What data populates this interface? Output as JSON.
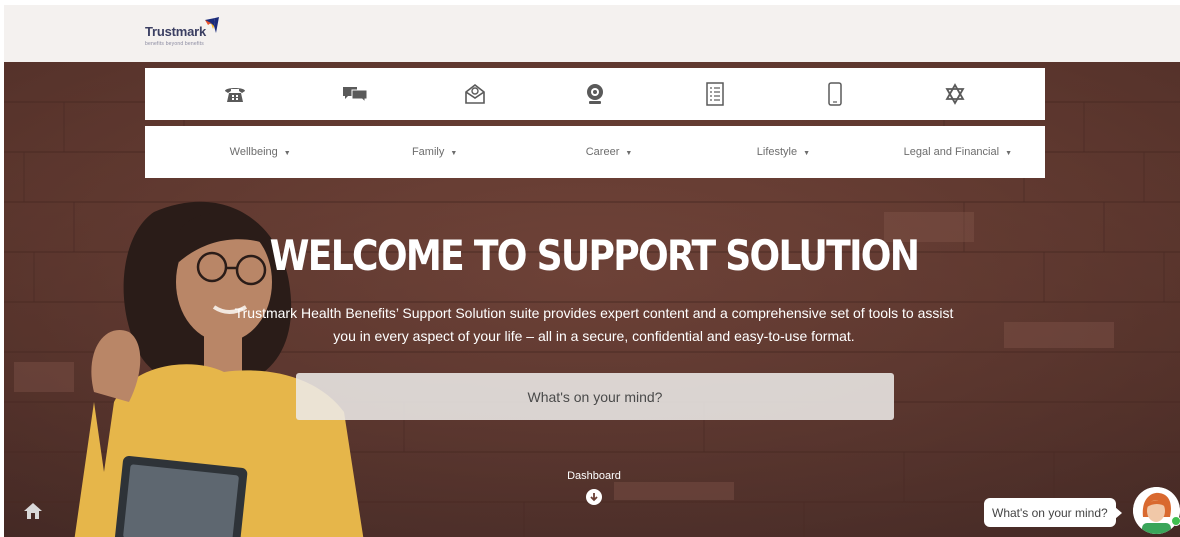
{
  "brand": {
    "name": "Trustmark",
    "tagline": "benefits beyond benefits",
    "mark_colors": [
      "#1b2b7a",
      "#e9522b",
      "#f6b11b"
    ]
  },
  "icon_bar": [
    {
      "icon": "phone-icon",
      "label": "Phone"
    },
    {
      "icon": "chat-icon",
      "label": "Chat"
    },
    {
      "icon": "email-icon",
      "label": "Email"
    },
    {
      "icon": "webcam-icon",
      "label": "Video"
    },
    {
      "icon": "checklist-icon",
      "label": "Checklist"
    },
    {
      "icon": "mobile-icon",
      "label": "Mobile"
    },
    {
      "icon": "star-icon",
      "label": "Favorites"
    }
  ],
  "menu": [
    {
      "label": "Wellbeing"
    },
    {
      "label": "Family"
    },
    {
      "label": "Career"
    },
    {
      "label": "Lifestyle"
    },
    {
      "label": "Legal and Financial"
    }
  ],
  "hero": {
    "title": "WELCOME TO SUPPORT SOLUTION",
    "intro_line1": "Trustmark Health Benefits’ Support Solution suite provides expert content and a comprehensive set of tools to assist",
    "intro_line2": "you in every aspect of your life – all in a secure, confidential and easy-to-use format.",
    "search_placeholder": "What's on your mind?"
  },
  "dashboard": {
    "label": "Dashboard"
  },
  "chat": {
    "prompt": "What's on your mind?"
  },
  "colors": {
    "hero_bg": "#6a3f35",
    "bar_bg": "#ffffff",
    "menu_text": "#6d6d6d",
    "online": "#3fbf4f"
  }
}
